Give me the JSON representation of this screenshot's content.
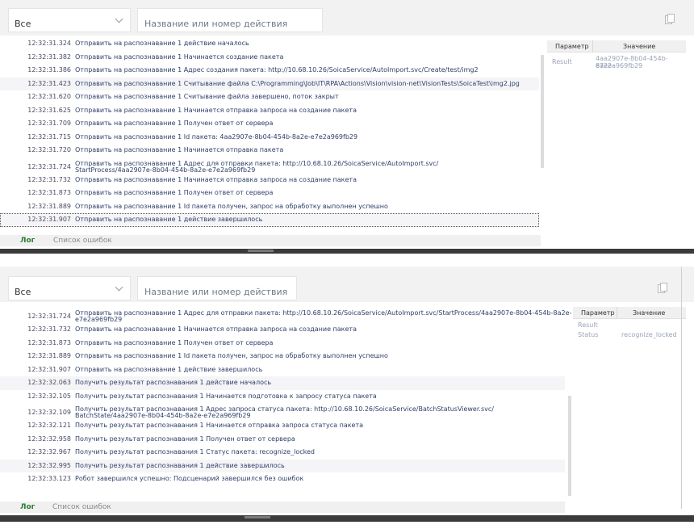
{
  "panels": [
    {
      "filter": {
        "value": "Все"
      },
      "search": {
        "placeholder": "Название или номер действия"
      },
      "log": [
        {
          "time": "12:32:31.324",
          "msg": "Отправить на распознавание 1 действие началось"
        },
        {
          "time": "12:32:31.382",
          "msg": "Отправить на распознавание 1 Начинается создание пакета"
        },
        {
          "time": "12:32:31.386",
          "msg": "Отправить на распознавание 1 Адрес создания пакета: http://10.68.10.26/SoicaService/AutoImport.svc/Create/test/img2"
        },
        {
          "time": "12:32:31.423",
          "msg": "Отправить на распознавание 1 Считывание файла C:\\Programming\\Job\\IT\\RPA\\Actions\\Vision\\vision-net\\VisionTests\\SoicaTest\\img2.jpg"
        },
        {
          "time": "12:32:31.620",
          "msg": "Отправить на распознавание 1 Считывание файла завершено, поток закрыт"
        },
        {
          "time": "12:32:31.625",
          "msg": "Отправить на распознавание 1 Начинается отправка запроса на создание пакета"
        },
        {
          "time": "12:32:31.709",
          "msg": "Отправить на распознавание 1 Получен ответ от сервера"
        },
        {
          "time": "12:32:31.715",
          "msg": "Отправить на распознавание 1 Id пакета: 4aa2907e-8b04-454b-8a2e-e7e2a969fb29"
        },
        {
          "time": "12:32:31.720",
          "msg": "Отправить на распознавание 1 Начинается отправка пакета"
        },
        {
          "time": "12:32:31.724",
          "msg": "Отправить на распознавание 1 Адрес для отправки пакета: http://10.68.10.26/SoicaService/AutoImport.svc/",
          "msg2": "StartProcess/4aa2907e-8b04-454b-8a2e-e7e2a969fb29"
        },
        {
          "time": "12:32:31.732",
          "msg": "Отправить на распознавание 1 Начинается отправка запроса на создание пакета"
        },
        {
          "time": "12:32:31.873",
          "msg": "Отправить на распознавание 1 Получен ответ от сервера"
        },
        {
          "time": "12:32:31.889",
          "msg": "Отправить на распознавание 1 Id пакета получен, запрос на обработку выполнен успешно"
        },
        {
          "time": "12:32:31.907",
          "msg": "Отправить на распознавание 1 действие завершилось"
        }
      ],
      "params_header": {
        "param": "Параметр",
        "value": "Значение"
      },
      "params": [
        {
          "name": "Result",
          "value": "4aa2907e-8b04-454b-8a2e-",
          "value2": "e7e2a969fb29"
        }
      ],
      "tabs": {
        "log": "Лог",
        "errors": "Список ошибок"
      }
    },
    {
      "filter": {
        "value": "Все"
      },
      "search": {
        "placeholder": "Название или номер действия"
      },
      "log": [
        {
          "time": "12:32:31.724",
          "msg": "Отправить на распознавание 1 Адрес для отправки пакета: http://10.68.10.26/SoicaService/AutoImport.svc/StartProcess/4aa2907e-8b04-454b-8a2e-",
          "msg2": "e7e2a969fb29"
        },
        {
          "time": "12:32:31.732",
          "msg": "Отправить на распознавание 1 Начинается отправка запроса на создание пакета"
        },
        {
          "time": "12:32:31.873",
          "msg": "Отправить на распознавание 1 Получен ответ от сервера"
        },
        {
          "time": "12:32:31.889",
          "msg": "Отправить на распознавание 1 Id пакета получен, запрос на обработку выполнен успешно"
        },
        {
          "time": "12:32:31.907",
          "msg": "Отправить на распознавание 1 действие завершилось"
        },
        {
          "time": "12:32:32.063",
          "msg": "Получить результат распознавания 1 действие началось"
        },
        {
          "time": "12:32:32.105",
          "msg": "Получить результат распознавания 1 Начинается подготовка к запросу статуса пакета"
        },
        {
          "time": "12:32:32.109",
          "msg": "Получить результат распознавания 1 Адрес запроса статуса пакета: http://10.68.10.26/SoicaService/BatchStatusViewer.svc/",
          "msg2": "BatchState/4aa2907e-8b04-454b-8a2e-e7e2a969fb29"
        },
        {
          "time": "12:32:32.121",
          "msg": "Получить результат распознавания 1 Начинается отправка запроса статуса пакета"
        },
        {
          "time": "12:32:32.958",
          "msg": "Получить результат распознавания 1 Получен ответ от сервера"
        },
        {
          "time": "12:32:32.967",
          "msg": "Получить результат распознавания 1 Статус пакета: recognize_locked"
        },
        {
          "time": "12:32:32.995",
          "msg": "Получить результат распознавания 1 действие завершилось"
        },
        {
          "time": "12:32:33.123",
          "msg": "Робот завершился успешно: Подсценарий завершился без ошибок"
        }
      ],
      "params_header": {
        "param": "Параметр",
        "value": "Значение"
      },
      "params": [
        {
          "name": "Result",
          "value": ""
        },
        {
          "name": "Status",
          "value": "recognize_locked"
        }
      ],
      "tabs": {
        "log": "Лог",
        "errors": "Список ошибок"
      }
    }
  ],
  "colors": {
    "accent_tab": "#2e7d32",
    "message_text": "#2e3f68",
    "param_text": "#9aa3b8"
  }
}
